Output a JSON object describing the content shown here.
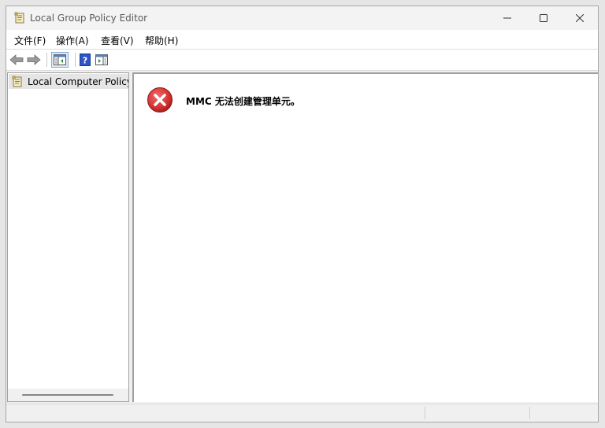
{
  "window": {
    "title": "Local Group Policy Editor",
    "icon": "policy-document-icon"
  },
  "menu": {
    "items": [
      {
        "label": "文件(F)"
      },
      {
        "label": "操作(A)"
      },
      {
        "label": "查看(V)"
      },
      {
        "label": "帮助(H)"
      }
    ]
  },
  "toolbar": {
    "buttons": [
      "back-arrow-icon",
      "forward-arrow-icon",
      "show-hide-console-tree-icon",
      "help-icon",
      "action-pane-icon"
    ]
  },
  "tree": {
    "items": [
      {
        "label": "Local Computer Policy",
        "icon": "policy-document-icon",
        "selected": true
      }
    ]
  },
  "main": {
    "error_message": "MMC 无法创建管理单元。",
    "icon": "error-x-icon"
  },
  "colors": {
    "error_red": "#d32f2f",
    "selection_gray": "#e5e5e5",
    "help_blue": "#2a56c6"
  }
}
